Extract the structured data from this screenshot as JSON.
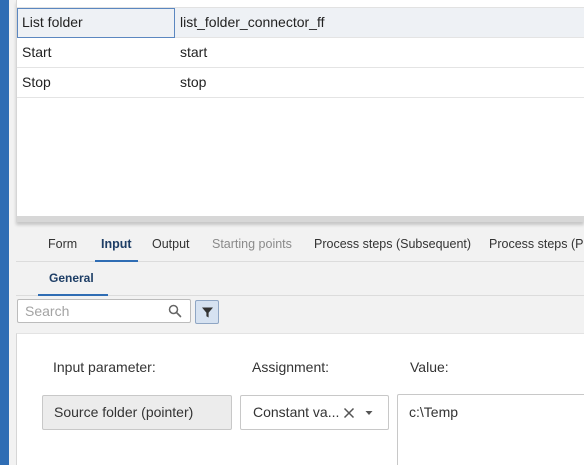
{
  "grid": {
    "rows": [
      {
        "name": "List folder",
        "value": "list_folder_connector_ff"
      },
      {
        "name": "Start",
        "value": "start"
      },
      {
        "name": "Stop",
        "value": "stop"
      }
    ]
  },
  "tabs": [
    {
      "label": "Form"
    },
    {
      "label": "Input"
    },
    {
      "label": "Output"
    },
    {
      "label": "Starting points"
    },
    {
      "label": "Process steps (Subsequent)"
    },
    {
      "label": "Process steps (Pr"
    }
  ],
  "subtabs": [
    {
      "label": "General"
    }
  ],
  "search": {
    "placeholder": "Search"
  },
  "form": {
    "input_param_label": "Input parameter:",
    "assignment_label": "Assignment:",
    "value_label": "Value:",
    "input_param_value": "Source folder (pointer)",
    "assignment_value": "Constant va...",
    "value_text": "c:\\Temp"
  },
  "colors": {
    "accent": "#2f6db4",
    "active_tab_text": "#1e3e66"
  }
}
